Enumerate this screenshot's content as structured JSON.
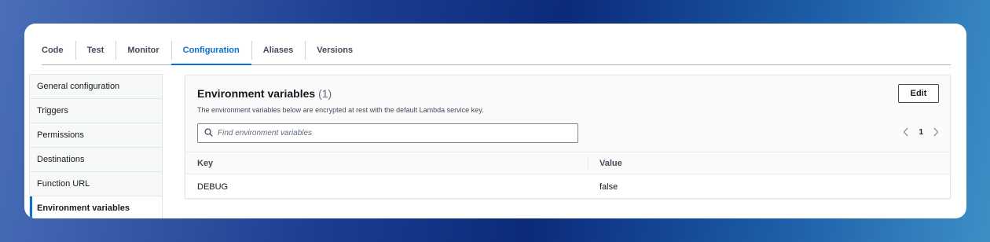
{
  "tabs": [
    {
      "label": "Code",
      "active": false
    },
    {
      "label": "Test",
      "active": false
    },
    {
      "label": "Monitor",
      "active": false
    },
    {
      "label": "Configuration",
      "active": true
    },
    {
      "label": "Aliases",
      "active": false
    },
    {
      "label": "Versions",
      "active": false
    }
  ],
  "sidebar": {
    "items": [
      {
        "label": "General configuration"
      },
      {
        "label": "Triggers"
      },
      {
        "label": "Permissions"
      },
      {
        "label": "Destinations"
      },
      {
        "label": "Function URL"
      },
      {
        "label": "Environment variables",
        "active": true
      }
    ]
  },
  "panel": {
    "title": "Environment variables",
    "count": "(1)",
    "description": "The environment variables below are encrypted at rest with the default Lambda service key.",
    "edit_label": "Edit",
    "search_placeholder": "Find environment variables",
    "search_icon": "search-icon",
    "page": "1"
  },
  "table": {
    "headers": {
      "key": "Key",
      "value": "Value"
    },
    "rows": [
      {
        "key": "DEBUG",
        "value": "false"
      }
    ]
  },
  "colors": {
    "accent": "#0972d3",
    "text": "#16191f",
    "background": "#ffffff"
  }
}
